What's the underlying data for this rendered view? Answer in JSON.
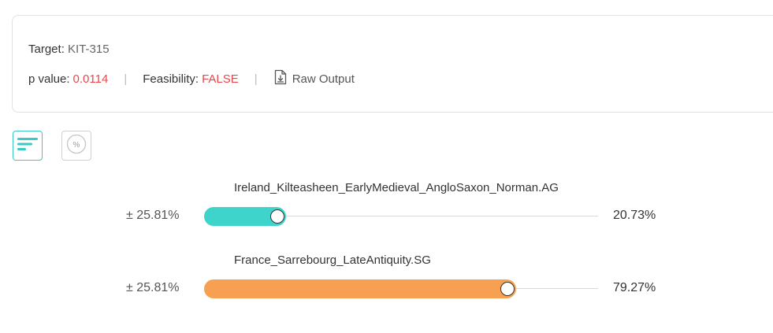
{
  "card": {
    "target_label": "Target:",
    "target_value": "KIT-315",
    "p_label": "p value:",
    "p_value": "0.0114",
    "feasibility_label": "Feasibility:",
    "feasibility_value": "FALSE",
    "separator": "|",
    "raw_output_label": "Raw Output"
  },
  "colors": {
    "accent": "#3ac9c3",
    "danger": "#e5484d",
    "teal_fill": "#3fd4cb",
    "orange_fill": "#f7a052"
  },
  "view_buttons": [
    {
      "icon": "bars-icon"
    },
    {
      "icon": "percent-icon",
      "text": "%"
    }
  ],
  "bars": [
    {
      "title": "Ireland_Kilteasheen_EarlyMedieval_AngloSaxon_Norman.AG",
      "plus_minus": "± 25.81%",
      "value_label": "20.73%",
      "fraction": 0.2073,
      "color": "#3fd4cb"
    },
    {
      "title": "France_Sarrebourg_LateAntiquity.SG",
      "plus_minus": "± 25.81%",
      "value_label": "79.27%",
      "fraction": 0.7927,
      "color": "#f7a052"
    }
  ]
}
